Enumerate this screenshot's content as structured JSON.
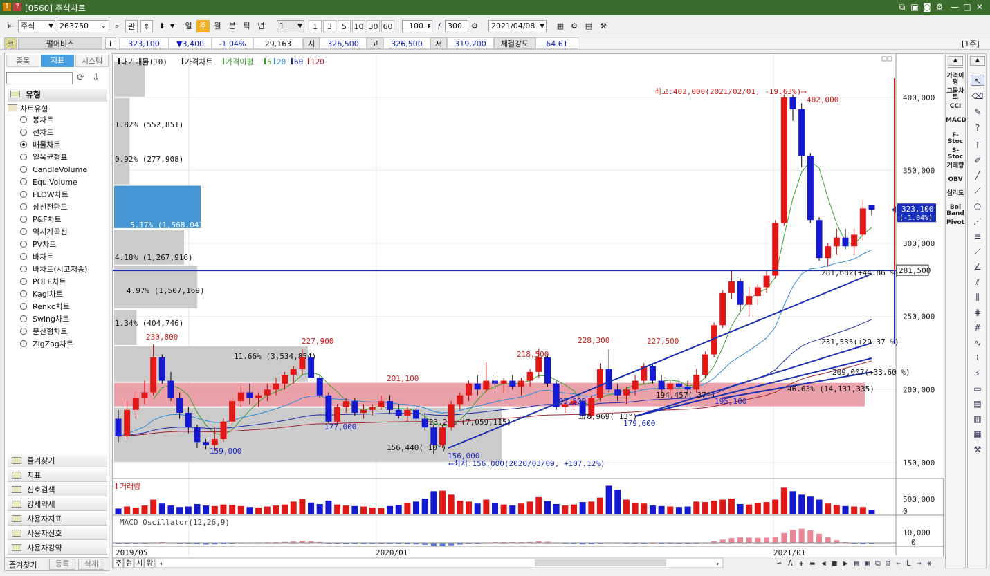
{
  "window": {
    "title_prefix": "[0560]",
    "title": "주식차트"
  },
  "toolbar": {
    "market": "주식",
    "code": "263750",
    "btn_gwan": "관",
    "periods": [
      "일",
      "주",
      "월",
      "분",
      "틱",
      "년"
    ],
    "active_period": "주",
    "interval_value": "1",
    "quick_intervals": [
      "1",
      "3",
      "5",
      "10",
      "30",
      "60"
    ],
    "count": "100",
    "total": "300",
    "slash": "/",
    "date": "2021/04/08"
  },
  "quote": {
    "co_label": "코",
    "name": "펄어비스",
    "info": "i",
    "price": "323,100",
    "change": "▼3,400",
    "change_pct": "-1.04%",
    "volume": "29,163",
    "open_label": "시",
    "open": "326,500",
    "high_label": "고",
    "high": "326,500",
    "low_label": "저",
    "low": "319,200",
    "strength_label": "체결강도",
    "strength": "64.61",
    "period_badge": "[1주]"
  },
  "left_panel": {
    "tabs": [
      "종목",
      "지표",
      "시스템"
    ],
    "active_tab": "지표",
    "section": "유형",
    "tree_root": "차트유형",
    "chart_types": [
      "봉차트",
      "선차트",
      "매물차트",
      "일목균형표",
      "CandleVolume",
      "EquiVolume",
      "FLOW차트",
      "삼선전환도",
      "P&F차트",
      "역시계곡선",
      "PV차트",
      "바차트",
      "바차트(시고저종)",
      "POLE차트",
      "Kagi차트",
      "Renko차트",
      "Swing차트",
      "분산형차트",
      "ZigZag차트"
    ],
    "selected_type": "매물차트",
    "folders": [
      "즐겨찾기",
      "지표",
      "신호검색",
      "강세약세",
      "사용자지표",
      "사용자신호",
      "사용자강약"
    ],
    "bottom_tabs": [
      "즐겨찾기",
      "등록",
      "삭제"
    ]
  },
  "price_panel": {
    "legend": [
      "대기매물(10)",
      "가격차트",
      "가격이평",
      "5",
      "20",
      "60",
      "120"
    ],
    "y_ticks": [
      "400,000",
      "350,000",
      "300,000",
      "250,000",
      "200,000",
      "150,000"
    ],
    "current_price_tag": "323,100",
    "current_pct_tag": "(-1.04%)",
    "hline_tag": "281,500",
    "max_note": "최고:402,000(2021/02/01, -19.63%)⟶",
    "min_note": "⟵최저:156,000(2020/03/09, +107.12%)",
    "volume_profile": [
      {
        "label": "1.82% (552,851)",
        "pct": 1.82
      },
      {
        "label": "0.92% (277,908)",
        "pct": 0.92
      },
      {
        "label": "5.17% (1,568,043)",
        "pct": 5.17
      },
      {
        "label": "4.18% (1,267,916)",
        "pct": 4.18
      },
      {
        "label": "4.97% (1,507,169)",
        "pct": 4.97
      },
      {
        "label": "1.34% (404,746)",
        "pct": 1.34
      },
      {
        "label": "11.66% (3,534,854)",
        "pct": 11.66
      },
      {
        "label": "46.63% (14,131,335)",
        "pct": 46.63
      },
      {
        "label": "23.26% (7,059,115)",
        "pct": 23.26
      }
    ],
    "peak_labels_red": [
      "230,800",
      "227,900",
      "218,500",
      "228,300",
      "227,500",
      "402,000",
      "201,100"
    ],
    "trough_labels_blue": [
      "159,000",
      "177,000",
      "156,000",
      "195,500",
      "179,600",
      "195,100"
    ],
    "trend_labels": [
      "156,440( 10°)",
      "178,969( 13°)",
      "194,457( 37°)",
      "281,682(+44.86 %)",
      "231,535(+29.37 %)",
      "209,007(+33.60 %)"
    ]
  },
  "volume_panel": {
    "title": "거래량",
    "y_ticks": [
      "500,000",
      "0"
    ]
  },
  "macd_panel": {
    "title": "MACD Oscillator(12,26,9)",
    "y_ticks": [
      "10,000",
      "0"
    ]
  },
  "x_axis": [
    "2019/05",
    "2020/01",
    "2021/01"
  ],
  "bottom_bar": {
    "buttons": [
      "주",
      "현",
      "시",
      "왕"
    ]
  },
  "right_indicators": [
    "가격이평",
    "그물차트",
    "CCI",
    "MACD",
    "F-Stoc",
    "S-Stoc",
    "거래량",
    "OBV",
    "심리도",
    "Bol Band",
    "Pivot"
  ],
  "chart_data": {
    "type": "candlestick",
    "y_range": [
      140000,
      425000
    ],
    "candles": [
      [
        180000,
        186000,
        164000,
        168000
      ],
      [
        168000,
        192000,
        166000,
        186000
      ],
      [
        186000,
        198000,
        180000,
        194000
      ],
      [
        194000,
        206000,
        190000,
        198000
      ],
      [
        198000,
        230800,
        196000,
        222000
      ],
      [
        222000,
        224000,
        204000,
        206000
      ],
      [
        206000,
        212000,
        192000,
        194000
      ],
      [
        194000,
        198000,
        180000,
        184000
      ],
      [
        184000,
        188000,
        170000,
        174000
      ],
      [
        174000,
        176000,
        160000,
        164000
      ],
      [
        164000,
        166000,
        159000,
        162000
      ],
      [
        162000,
        174000,
        158000,
        166000
      ],
      [
        166000,
        180000,
        164000,
        178000
      ],
      [
        178000,
        194000,
        176000,
        192000
      ],
      [
        192000,
        202000,
        188000,
        198000
      ],
      [
        198000,
        204000,
        190000,
        194000
      ],
      [
        194000,
        198000,
        188000,
        196000
      ],
      [
        196000,
        204000,
        192000,
        200000
      ],
      [
        200000,
        208000,
        196000,
        204000
      ],
      [
        204000,
        212000,
        200000,
        210000
      ],
      [
        210000,
        216000,
        204000,
        214000
      ],
      [
        214000,
        227900,
        210000,
        222000
      ],
      [
        222000,
        226000,
        206000,
        208000
      ],
      [
        208000,
        210000,
        194000,
        196000
      ],
      [
        196000,
        198000,
        177000,
        178000
      ],
      [
        178000,
        190000,
        176000,
        188000
      ],
      [
        188000,
        194000,
        184000,
        192000
      ],
      [
        192000,
        194000,
        182000,
        184000
      ],
      [
        184000,
        190000,
        180000,
        186000
      ],
      [
        186000,
        190000,
        182000,
        188000
      ],
      [
        188000,
        196000,
        186000,
        192000
      ],
      [
        192000,
        196000,
        184000,
        186000
      ],
      [
        186000,
        190000,
        180000,
        182000
      ],
      [
        182000,
        188000,
        178000,
        186000
      ],
      [
        186000,
        190000,
        178000,
        180000
      ],
      [
        180000,
        184000,
        172000,
        174000
      ],
      [
        174000,
        176000,
        156000,
        162000
      ],
      [
        162000,
        176000,
        160000,
        174000
      ],
      [
        174000,
        192000,
        172000,
        190000
      ],
      [
        190000,
        198000,
        186000,
        196000
      ],
      [
        196000,
        206000,
        192000,
        204000
      ],
      [
        204000,
        210000,
        196000,
        200000
      ],
      [
        200000,
        218500,
        198000,
        206000
      ],
      [
        206000,
        212000,
        200000,
        204000
      ],
      [
        204000,
        208000,
        198000,
        206000
      ],
      [
        206000,
        210000,
        200000,
        202000
      ],
      [
        202000,
        208000,
        196000,
        206000
      ],
      [
        206000,
        214000,
        202000,
        212000
      ],
      [
        212000,
        228300,
        208000,
        222000
      ],
      [
        222000,
        224000,
        202000,
        204000
      ],
      [
        204000,
        206000,
        186000,
        188000
      ],
      [
        188000,
        192000,
        184000,
        190000
      ],
      [
        190000,
        196000,
        186000,
        192000
      ],
      [
        192000,
        194000,
        179600,
        182000
      ],
      [
        182000,
        196000,
        180000,
        194000
      ],
      [
        194000,
        218000,
        192000,
        214000
      ],
      [
        214000,
        227500,
        198000,
        200000
      ],
      [
        200000,
        204000,
        192000,
        196000
      ],
      [
        196000,
        202000,
        190000,
        200000
      ],
      [
        200000,
        210000,
        196000,
        206000
      ],
      [
        206000,
        218000,
        204000,
        216000
      ],
      [
        216000,
        218000,
        204000,
        206000
      ],
      [
        206000,
        210000,
        198000,
        200000
      ],
      [
        200000,
        206000,
        196000,
        204000
      ],
      [
        204000,
        208000,
        198000,
        202000
      ],
      [
        202000,
        206000,
        195100,
        200000
      ],
      [
        200000,
        214000,
        198000,
        210000
      ],
      [
        210000,
        226000,
        208000,
        224000
      ],
      [
        224000,
        246000,
        222000,
        244000
      ],
      [
        244000,
        268000,
        242000,
        266000
      ],
      [
        266000,
        282000,
        262000,
        274000
      ],
      [
        274000,
        276000,
        254000,
        258000
      ],
      [
        258000,
        270000,
        250000,
        264000
      ],
      [
        264000,
        272000,
        258000,
        270000
      ],
      [
        270000,
        282000,
        266000,
        278000
      ],
      [
        278000,
        316000,
        276000,
        314000
      ],
      [
        314000,
        402000,
        312000,
        400000
      ],
      [
        400000,
        402000,
        384000,
        392000
      ],
      [
        392000,
        396000,
        352000,
        360000
      ],
      [
        360000,
        362000,
        314000,
        316000
      ],
      [
        316000,
        318000,
        288000,
        290000
      ],
      [
        290000,
        300000,
        284000,
        298000
      ],
      [
        298000,
        310000,
        292000,
        304000
      ],
      [
        304000,
        310000,
        296000,
        298000
      ],
      [
        298000,
        310000,
        292000,
        306000
      ],
      [
        306000,
        330000,
        302000,
        324000
      ],
      [
        326500,
        326500,
        319200,
        323100
      ]
    ],
    "volume": [
      120,
      160,
      140,
      180,
      300,
      220,
      180,
      150,
      160,
      210,
      180,
      170,
      200,
      190,
      170,
      150,
      140,
      160,
      180,
      200,
      260,
      310,
      240,
      210,
      280,
      200,
      180,
      170,
      160,
      140,
      130,
      170,
      190,
      230,
      260,
      320,
      470,
      480,
      400,
      280,
      260,
      220,
      300,
      230,
      200,
      180,
      220,
      260,
      350,
      270,
      210,
      180,
      200,
      250,
      260,
      340,
      580,
      500,
      300,
      230,
      220,
      180,
      170,
      160,
      150,
      160,
      260,
      250,
      280,
      300,
      320,
      210,
      200,
      230,
      250,
      300,
      540,
      470,
      400,
      360,
      300,
      220,
      190,
      170,
      160,
      150,
      90
    ],
    "macd": [
      -200,
      -300,
      -250,
      -150,
      200,
      300,
      150,
      -100,
      -300,
      -600,
      -800,
      -700,
      -500,
      -200,
      100,
      200,
      200,
      250,
      300,
      400,
      600,
      900,
      700,
      400,
      -100,
      -300,
      -400,
      -500,
      -500,
      -500,
      -400,
      -400,
      -500,
      -600,
      -700,
      -900,
      -1400,
      -1500,
      -1200,
      -800,
      -400,
      -100,
      200,
      300,
      350,
      300,
      300,
      400,
      700,
      500,
      100,
      -300,
      -500,
      -700,
      -600,
      -300,
      200,
      100,
      -100,
      -200,
      -100,
      0,
      -100,
      -200,
      -300,
      -300,
      -200,
      100,
      700,
      1500,
      2200,
      2500,
      2400,
      2300,
      2400,
      2700,
      4500,
      6000,
      6500,
      5800,
      4200,
      2500,
      1200,
      300,
      -300,
      -600,
      -500
    ]
  }
}
